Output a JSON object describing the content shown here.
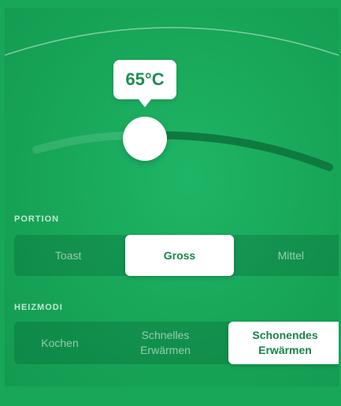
{
  "temperature": {
    "value_label": "65°C",
    "level": 0.3
  },
  "portion": {
    "label": "PORTION",
    "options": [
      "Toast",
      "Gross",
      "Mittel"
    ],
    "selected": "Gross"
  },
  "heizmodi": {
    "label": "HEIZMODI",
    "options": [
      "Kochen",
      "Schnelles Erwärmen",
      "Schonendes Erwärmen"
    ],
    "selected": "Schonendes Erwärmen"
  },
  "colors": {
    "accent": "#18a659",
    "track_dark": "#0f7a3f",
    "white": "#ffffff"
  }
}
